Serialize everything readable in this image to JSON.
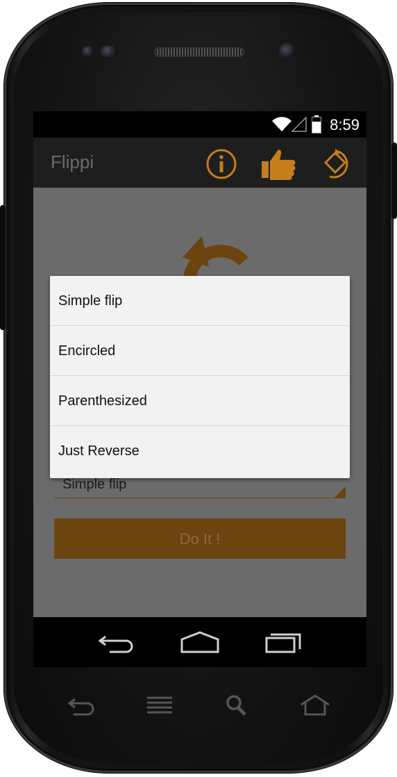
{
  "status_bar": {
    "time": "8:59"
  },
  "action_bar": {
    "title": "Flippi",
    "icons": [
      "info-icon",
      "thumbs-up-icon",
      "flip-icon"
    ]
  },
  "spinner": {
    "selected": "Simple flip"
  },
  "do_it_button": {
    "label": "Do It !"
  },
  "dialog": {
    "options": [
      {
        "label": "Simple flip"
      },
      {
        "label": "Encircled"
      },
      {
        "label": "Parenthesized"
      },
      {
        "label": "Just Reverse"
      }
    ]
  },
  "nav_bar": {
    "icons": [
      "back-icon",
      "home-icon",
      "recent-apps-icon"
    ]
  },
  "hardware_buttons": {
    "icons": [
      "back-icon",
      "menu-icon",
      "search-icon",
      "home-icon"
    ]
  },
  "colors": {
    "accent": "#c47f1a",
    "dim_accent": "#6c4410",
    "dialog_bg": "#f2f2f2"
  }
}
